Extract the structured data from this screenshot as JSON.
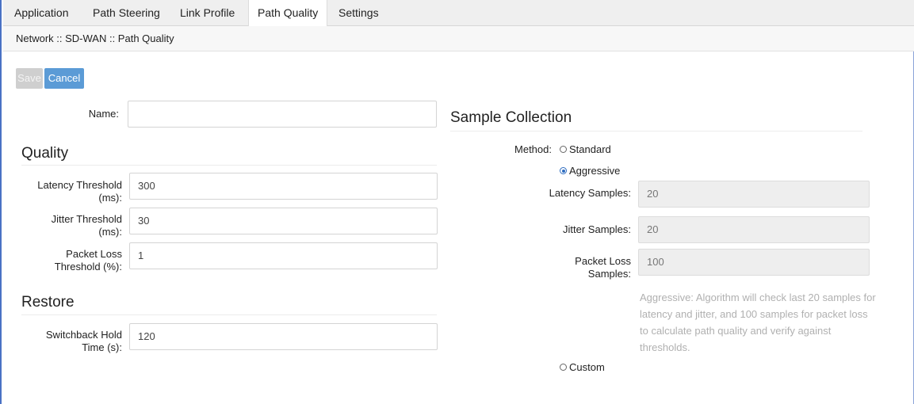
{
  "tabs": [
    "Application",
    "Path Steering",
    "Link Profile",
    "Path Quality",
    "Settings"
  ],
  "active_tab": "Path Quality",
  "breadcrumb": "Network :: SD-WAN :: Path Quality",
  "buttons": {
    "save": "Save",
    "cancel": "Cancel"
  },
  "form": {
    "name_label": "Name:",
    "name_value": ""
  },
  "quality": {
    "title": "Quality",
    "latency_label": "Latency Threshold (ms):",
    "latency_value": "300",
    "jitter_label": "Jitter Threshold (ms):",
    "jitter_value": "30",
    "loss_label": "Packet Loss Threshold (%):",
    "loss_value": "1"
  },
  "restore": {
    "title": "Restore",
    "hold_label": "Switchback Hold Time (s):",
    "hold_value": "120"
  },
  "sample": {
    "title": "Sample Collection",
    "method_label": "Method:",
    "options": {
      "standard": "Standard",
      "aggressive": "Aggressive",
      "custom": "Custom"
    },
    "selected": "Aggressive",
    "latency_samples_label": "Latency Samples:",
    "latency_samples_value": "20",
    "jitter_samples_label": "Jitter Samples:",
    "jitter_samples_value": "20",
    "loss_samples_label": "Packet Loss Samples:",
    "loss_samples_value": "100",
    "hint": "Aggressive: Algorithm will check last 20 samples for latency and jitter, and 100 samples for packet loss to calculate path quality and verify against thresholds."
  },
  "colors": {
    "accent": "#5b9bd6",
    "radio_selected": "#2d6cc0",
    "frame": "#4a72c4"
  }
}
